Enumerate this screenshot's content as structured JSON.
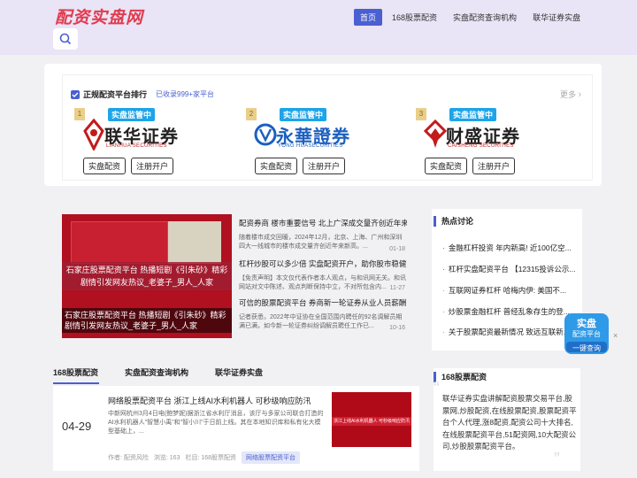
{
  "header": {
    "logo_text": "配资实盘网",
    "nav": [
      "首页",
      "168股票配资",
      "实盘配资查询机构",
      "联华证券实盘"
    ],
    "search_icon": "search-icon"
  },
  "ranking": {
    "title": "正规配资平台排行",
    "subtitle": "已收录999+家平台",
    "more": "更多",
    "brokers": [
      {
        "rank": "1",
        "badge": "实盘监管中",
        "name": "联华证券",
        "sub": "LIANHUA SECURITIES",
        "btn1": "实盘配资",
        "btn2": "注册开户",
        "color": "#c41a1a"
      },
      {
        "rank": "2",
        "badge": "实盘监管中",
        "name": "永華證券",
        "sub": "YONG HUASECURITIES",
        "btn1": "实盘配资",
        "btn2": "注册开户",
        "color": "#1c5fbf"
      },
      {
        "rank": "3",
        "badge": "实盘监管中",
        "name": "财盛证券",
        "sub": "CAISHENG SECURITIES",
        "btn1": "实盘配资",
        "btn2": "注册开户",
        "color": "#c41a1a"
      }
    ]
  },
  "feature": {
    "overlay": "石家庄股票配资平台 热播短剧《引朱砂》精彩剧情引发网友热议_老婆子_男人_人家",
    "caption": "石家庄股票配资平台 热播短剧《引朱砂》精彩剧情引发网友热议_老婆子_男人_人家"
  },
  "news": [
    {
      "title": "配资券商 楼市重要信号 北上广深成交量齐创近年来...",
      "desc": "随着楼市成交回暖，2024年12月，北京、上海、广州和深圳四大一线城市的楼市成交量齐创近年来新高。...",
      "date": "01-18"
    },
    {
      "title": "杠杆炒股可以多少倍 实盘配资开户，助你股市稳健...",
      "desc": "【免责声明】本文仅代表作者本人观点，与和讯网无关。和讯网站对文中陈述、观点判断保持中立，不对所包含内...",
      "date": "11-27"
    },
    {
      "title": "可信的股票配资平台 券商新一轮证券从业人员薪酬...",
      "desc": "记者获悉，2022年中证协在全国范围内聘任的92名调解员期满已满，如今新一轮证券纠纷调解员聘任工作已...",
      "date": "10-16"
    }
  ],
  "hot": {
    "title": "热点讨论",
    "items": [
      "金融杠杆投资 年内新高! 近100亿空...",
      "杠杆实盘配资平台 【12315投诉公示...",
      "互联网证券杠杆 哈梅内伊: 美国不...",
      "炒股票金融杠杆 普经乱象存生的登...",
      "关于股票配资最新情况 致远互联新..."
    ]
  },
  "float_badge": {
    "line1": "实盘",
    "line2": "配资平台",
    "line3": "一键查询",
    "close": "×"
  },
  "tabs": [
    "168股票配资",
    "实盘配资查询机构",
    "联华证券实盘"
  ],
  "list_item": {
    "date": "04-29",
    "title": "网络股票配资平台 浙江上线AI水利机器人 可秒级响应防汛",
    "desc": "中新网杭州3月4日电(鲍梦妮)据浙江省水利厅消息，该厅与多家公司联合打造的AI水利机器人\"智慧小禹\"和\"智小川\"于日前上线。其在本地知识库和私有化大模型基础上，...",
    "author": "作者: 配资风险",
    "views": "浏览: 163",
    "category": "栏目: 168股票配资",
    "chip": "网络股票配资平台",
    "thumb_text": "浙江上线AI水利机器人 可秒级响应防汛"
  },
  "side": {
    "title": "168股票配资",
    "text": "联华证券实盘讲解配资股票交易平台,股票网,炒股配资,在线股票配资,股票配资平台个人代理,涨8配资,配资公司十大排名,在线股票配资平台,51配资网,10大配资公司,炒股股票配资平台。"
  }
}
